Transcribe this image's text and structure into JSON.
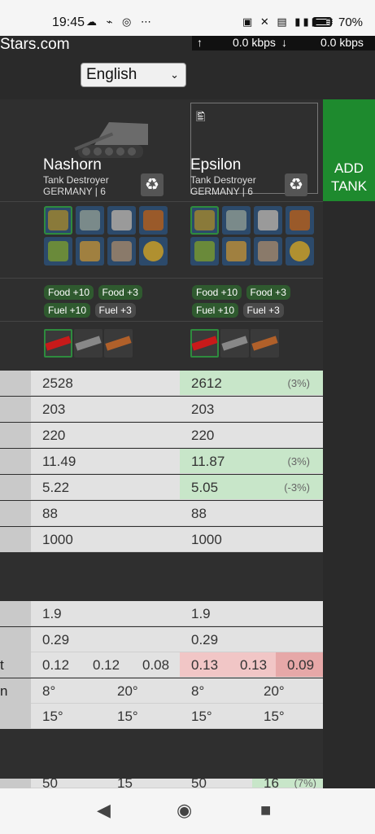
{
  "status_bar": {
    "time": "19:45",
    "left_icons": "☁ ⌁ ◎ ⋯",
    "right_icons": "▣ ✕ ▤ ▮▮▮ ≋",
    "battery": "70%"
  },
  "header": {
    "site": "Stars.com",
    "upload_arrow": "↑",
    "upload": "0.0 kbps",
    "download_arrow": "↓",
    "download": "0.0 kbps",
    "language": "English",
    "language_chevron": "⌄"
  },
  "add_tank": {
    "line1": "ADD",
    "line2": "TANK"
  },
  "tanks": [
    {
      "name": "Nashorn",
      "class": "Tank Destroyer",
      "nation_tier": "GERMANY | 6",
      "badges": [
        "Food +10",
        "Food +3",
        "Fuel +10",
        "Fuel +3"
      ]
    },
    {
      "name": "Epsilon",
      "class": "Tank Destroyer",
      "nation_tier": "GERMANY | 6",
      "badges": [
        "Food +10",
        "Food +3",
        "Fuel +10",
        "Fuel +3"
      ]
    }
  ],
  "recycle_icon": "♻",
  "image_icon": "🖺",
  "stats_rows": [
    {
      "label": "",
      "a": "2528",
      "b": "2612",
      "b_diff": "(3%)",
      "b_state": "up"
    },
    {
      "label": "",
      "a": "203",
      "b": "203",
      "b_diff": "",
      "b_state": ""
    },
    {
      "label": "",
      "a": "220",
      "b": "220",
      "b_diff": "",
      "b_state": ""
    },
    {
      "label": "",
      "a": "11.49",
      "b": "11.87",
      "b_diff": "(3%)",
      "b_state": "up"
    },
    {
      "label": "",
      "a": "5.22",
      "b": "5.05",
      "b_diff": "(-3%)",
      "b_state": "up"
    },
    {
      "label": "",
      "a": "88",
      "b": "88",
      "b_diff": "",
      "b_state": ""
    },
    {
      "label": "",
      "a": "1000",
      "b": "1000",
      "b_diff": "",
      "b_state": ""
    }
  ],
  "stats_rows2": [
    {
      "label": "",
      "a": "1.9",
      "b": "1.9"
    },
    {
      "label": "",
      "a": "0.29",
      "b": "0.29"
    }
  ],
  "dispersion_row": {
    "label": "t",
    "a": [
      "0.12",
      "0.12",
      "0.08"
    ],
    "b": [
      "0.13",
      "0.13",
      "0.09"
    ]
  },
  "angle_rows": [
    {
      "label": "n",
      "a": [
        "8°",
        "20°"
      ],
      "b": [
        "8°",
        "20°"
      ]
    },
    {
      "label": "",
      "a": [
        "15°",
        "15°"
      ],
      "b": [
        "15°",
        "15°"
      ]
    }
  ],
  "partial_row": {
    "a": [
      "50",
      "15"
    ],
    "b": [
      "50",
      "16",
      "(7%)"
    ]
  },
  "nav": {
    "back": "◀",
    "home": "◉",
    "recent": "■"
  }
}
